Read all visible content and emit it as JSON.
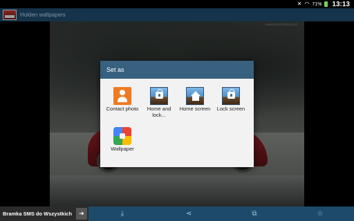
{
  "status_bar": {
    "clock": "13:13",
    "battery_percent": "71%",
    "icons": [
      "mute-icon",
      "wifi-icon",
      "battery-icon"
    ]
  },
  "action_bar": {
    "title": "Holden wallpapers",
    "icon": "app-car-icon"
  },
  "image": {
    "watermark": "www.AutoDesktop.pl"
  },
  "dialog": {
    "title": "Set as",
    "options": [
      {
        "label": "Contact photo",
        "icon": "contact-photo-icon"
      },
      {
        "label": "Home and lock...",
        "icon": "home-lock-screen-icon"
      },
      {
        "label": "Home screen",
        "icon": "home-screen-icon"
      },
      {
        "label": "Lock screen",
        "icon": "lock-screen-icon"
      },
      {
        "label": "Wallpaper",
        "icon": "wallpaper-icon"
      }
    ]
  },
  "bottom_bar": {
    "ad_text": "Bramka SMS do Wszystkich",
    "ad_arrow": "➔",
    "buttons": [
      {
        "name": "download",
        "glyph": "⤓"
      },
      {
        "name": "share",
        "glyph": "⋖"
      },
      {
        "name": "crop",
        "glyph": "⧉"
      },
      {
        "name": "favorite",
        "glyph": "☆"
      }
    ]
  },
  "colors": {
    "action_bar": "#1f4c6e",
    "dialog_header": "#38607f",
    "bottom_bar": "#1d4a6b"
  }
}
